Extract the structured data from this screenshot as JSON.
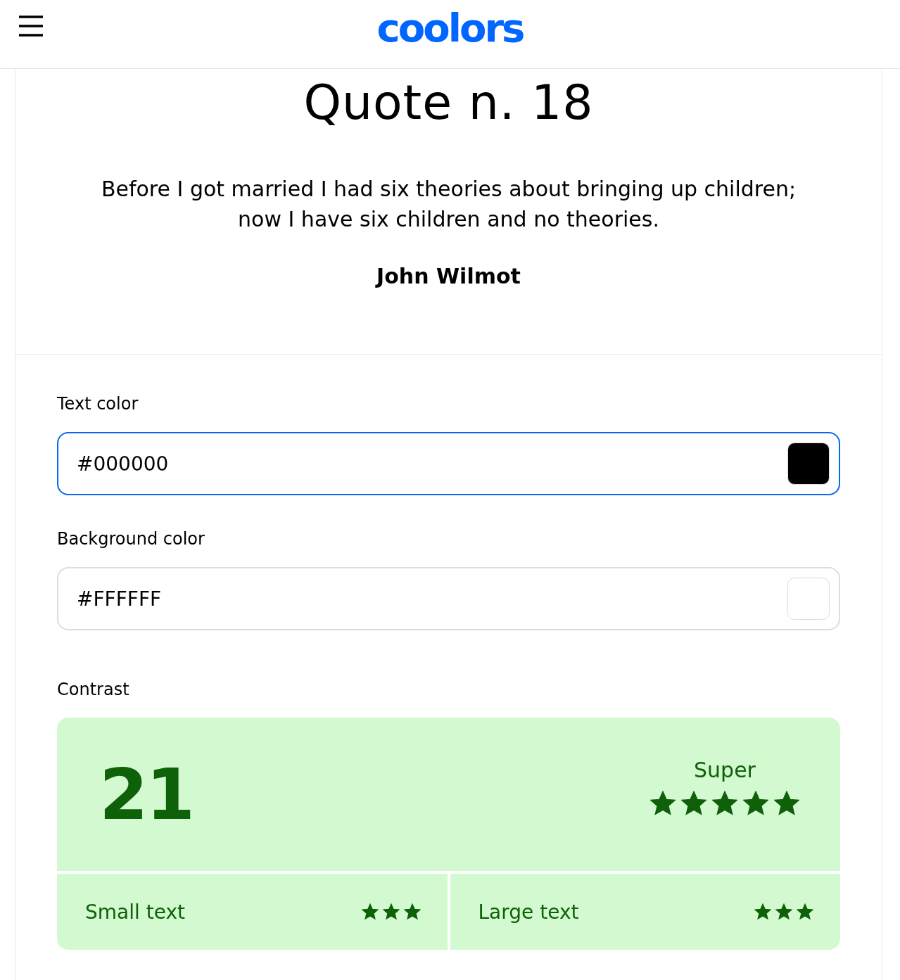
{
  "header": {
    "logo": "coolors"
  },
  "quote": {
    "title": "Quote n. 18",
    "text": "Before I got married I had six theories about bringing up children; now I have six children and no theories.",
    "author": "John Wilmot"
  },
  "fields": [
    {
      "label": "Text color",
      "value": "#000000",
      "focused": true
    },
    {
      "label": "Background color",
      "value": "#FFFFFF",
      "focused": false
    }
  ],
  "contrast": {
    "label": "Contrast",
    "ratio": "21",
    "rating": "Super",
    "stars": 5,
    "parts": [
      {
        "label": "Small text",
        "stars": 3
      },
      {
        "label": "Large text",
        "stars": 3
      }
    ]
  }
}
